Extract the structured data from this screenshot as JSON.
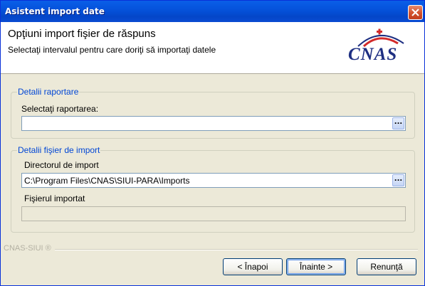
{
  "window": {
    "title": "Asistent import date"
  },
  "header": {
    "title": "Opţiuni import fişier de răspuns",
    "subtitle": "Selectaţi intervalul pentru care doriţi să importaţi datele",
    "logo_text": "CNAS"
  },
  "group_report": {
    "legend": "Detalii raportare",
    "select_label": "Selectaţi raportarea:",
    "select_value": "",
    "browse_label": "..."
  },
  "group_import": {
    "legend": "Detalii fişier de import",
    "dir_label": "Directorul de import",
    "dir_value": "C:\\Program Files\\CNAS\\SIUI-PARA\\Imports",
    "browse_label": "...",
    "file_label": "Fişierul importat",
    "file_value": ""
  },
  "footer": {
    "brand": "CNAS-SIUI ®"
  },
  "buttons": {
    "back": "< Înapoi",
    "next": "Înainte >",
    "cancel": "Renunţă"
  },
  "colors": {
    "titlebar": "#0553dc",
    "legend": "#0046d5",
    "logo": "#1e2f82",
    "logo_arc": "#d22a2a"
  }
}
